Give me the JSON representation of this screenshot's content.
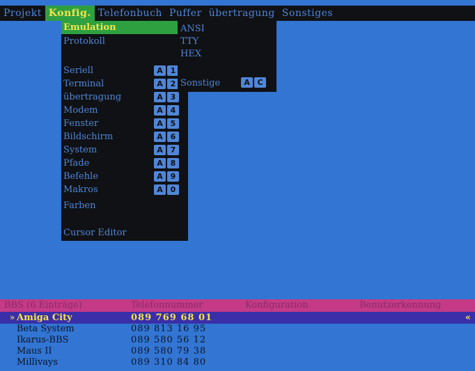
{
  "menubar": {
    "items": [
      "Projekt",
      "Konfig.",
      "Telefonbuch",
      "Puffer",
      "übertragung",
      "Sonstiges"
    ]
  },
  "konfig_menu": {
    "items": [
      {
        "label": "Emulation"
      },
      {
        "label": "Protokoll"
      },
      {
        "label": ""
      },
      {
        "label": "Seriell",
        "key": [
          "A",
          "1"
        ]
      },
      {
        "label": "Terminal",
        "key": [
          "A",
          "2"
        ]
      },
      {
        "label": "übertragung",
        "key": [
          "A",
          "3"
        ]
      },
      {
        "label": "Modem",
        "key": [
          "A",
          "4"
        ]
      },
      {
        "label": "Fenster",
        "key": [
          "A",
          "5"
        ]
      },
      {
        "label": "Bildschirm",
        "key": [
          "A",
          "6"
        ]
      },
      {
        "label": "System",
        "key": [
          "A",
          "7"
        ]
      },
      {
        "label": "Pfade",
        "key": [
          "A",
          "8"
        ]
      },
      {
        "label": "Befehle",
        "key": [
          "A",
          "9"
        ]
      },
      {
        "label": "Makros",
        "key": [
          "A",
          "0"
        ]
      },
      {
        "label": "Farben"
      },
      {
        "label": ""
      },
      {
        "label": "Cursor Editor"
      }
    ]
  },
  "emulation_submenu": {
    "items": [
      "ANSI",
      "TTY",
      "HEX"
    ],
    "sonstige": {
      "label": "Sonstige",
      "key": [
        "A",
        "C"
      ]
    }
  },
  "phonebook": {
    "headers": {
      "bbs": "BBS (6 Einträge)",
      "telefon": "Telefonnummer",
      "konfiguration": "Konfiguration",
      "benutzer": "Benutzerkennung"
    },
    "selected_marker": "»",
    "scroll_marker": "«",
    "rows": [
      {
        "name": "Amiga City",
        "phone": "089 769 68 01",
        "selected": true
      },
      {
        "name": "Beta System",
        "phone": "089 813 16 95"
      },
      {
        "name": "Ikarus-BBS",
        "phone": "089 580 56 12"
      },
      {
        "name": "Maus II",
        "phone": "089 580 79 38"
      },
      {
        "name": "Millivays",
        "phone": "089 310 84 80"
      }
    ]
  },
  "colors": {
    "screen_bg": "#3275d3",
    "menu_bg": "#101114",
    "menu_text": "#4f86d8",
    "highlight_bg": "#2ea040",
    "highlight_text": "#f4e54c",
    "header_bg": "#c43a86",
    "selected_row_bg": "#3a2fa8"
  }
}
